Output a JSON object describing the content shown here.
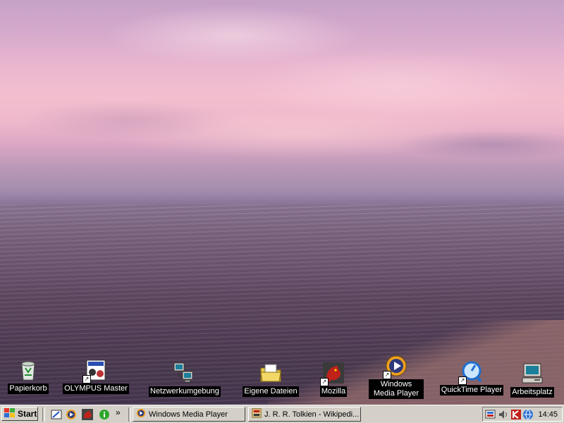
{
  "desktop": {
    "icons": [
      {
        "label": "Papierkorb",
        "icon": "recycle-bin-icon"
      },
      {
        "label": "OLYMPUS Master",
        "icon": "olympus-master-icon"
      },
      {
        "label": "Netzwerkumgebung",
        "icon": "network-neighborhood-icon"
      },
      {
        "label": "Eigene Dateien",
        "icon": "my-documents-icon"
      },
      {
        "label": "Mozilla",
        "icon": "mozilla-icon"
      },
      {
        "label": "Windows Media Player",
        "icon": "windows-media-player-icon"
      },
      {
        "label": "QuickTime Player",
        "icon": "quicktime-icon"
      },
      {
        "label": "Arbeitsplatz",
        "icon": "my-computer-icon"
      }
    ]
  },
  "taskbar": {
    "start_label": "Start",
    "quicklaunch_more": "»",
    "tasks": [
      {
        "label": "Windows Media Player",
        "icon": "windows-media-player-icon"
      },
      {
        "label": "J. R. R. Tolkien - Wikipedi...",
        "icon": "browser-page-icon"
      }
    ],
    "tray": {
      "clock": "14:45"
    }
  },
  "colors": {
    "taskbar": "#d4d0c8",
    "label_bg": "#000000",
    "label_fg": "#ffffff"
  }
}
